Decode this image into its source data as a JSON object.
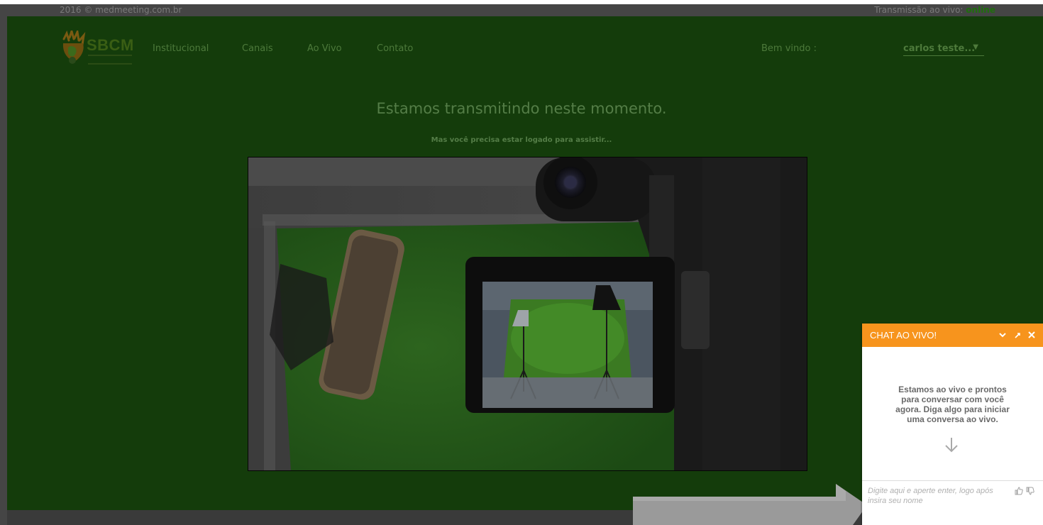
{
  "topbar": {
    "copyright": "2016 © medmeeting.com.br",
    "status_label": "Transmissão ao vivo:",
    "status_value": "online"
  },
  "header": {
    "brand": "SBCM",
    "nav": [
      "Institucional",
      "Canais",
      "Ao Vivo",
      "Contato"
    ],
    "welcome": "Bem vindo :",
    "user": "carlos teste...",
    "user_caret": "▼"
  },
  "main": {
    "headline": "Estamos transmitindo neste momento.",
    "subline": "Mas você precisa estar logado para assistir..."
  },
  "chat": {
    "title": "CHAT AO VIVO!",
    "welcome": "Estamos ao vivo e prontos para conversar com você agora. Diga algo para iniciar uma conversa ao vivo.",
    "placeholder": "Digite aqui e aperte enter, logo após insira seu nome"
  },
  "colors": {
    "background": "#143c0b",
    "online": "#1f6f0d",
    "chat_accent": "#f7941d"
  },
  "icons": [
    "hand-logo-icon",
    "chevron-down-icon",
    "popout-icon",
    "close-icon",
    "arrow-down-icon",
    "thumbs-up-icon",
    "thumbs-down-icon"
  ]
}
